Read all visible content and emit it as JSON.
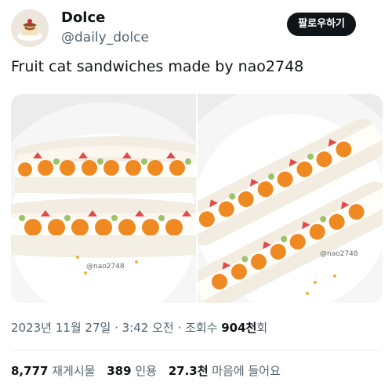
{
  "author": {
    "display_name": "Dolce",
    "handle": "@daily_dolce",
    "avatar_icon": "pudding-avatar"
  },
  "follow_label": "팔로우하기",
  "tweet_text": "Fruit cat sandwiches made by nao2748",
  "media": {
    "photo_count": 2,
    "watermark": "@nao2748"
  },
  "meta": {
    "date": "2023년 11월 27일",
    "time": "3:42 오전",
    "views_prefix": "조회수",
    "views_value": "904천",
    "views_suffix": "회",
    "separator": "·"
  },
  "stats": {
    "retweets": {
      "value": "8,777",
      "label": "재게시물"
    },
    "quotes": {
      "value": "389",
      "label": "인용"
    },
    "likes": {
      "value": "27.3천",
      "label": "마음에 들어요"
    }
  }
}
